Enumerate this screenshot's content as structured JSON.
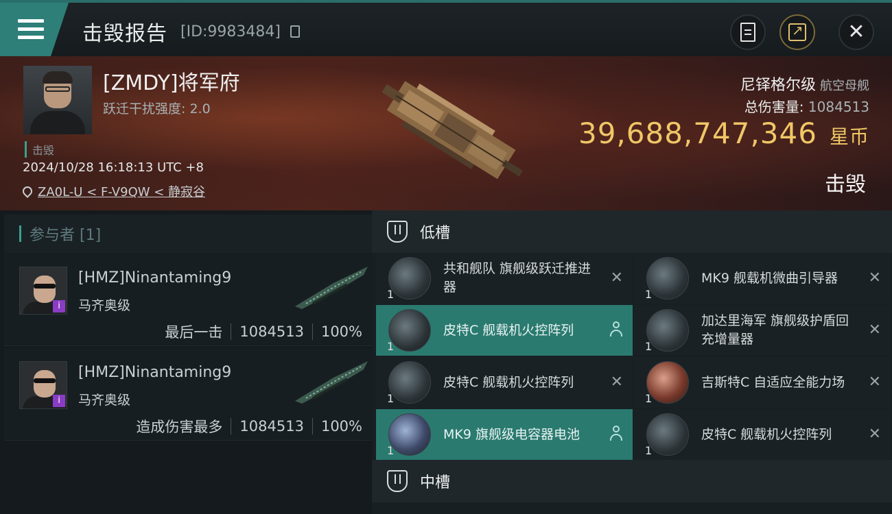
{
  "header": {
    "title": "击毁报告",
    "report_id": "[ID:9983484]",
    "menu_icon": "hamburger-menu-icon",
    "accent": "#2d7f78"
  },
  "victim": {
    "name": "[ZMDY]将军府",
    "jump_jam": "跃迁干扰强度: 2.0",
    "tag": "击毁",
    "datetime": "2024/10/28 16:18:13 UTC +8",
    "location": "ZA0L-U < F-V9QW < 静寂谷",
    "ship_name": "尼铎格尔级",
    "ship_type": "航空母舰",
    "total_damage_label": "总伤害量:",
    "total_damage": "1084513",
    "isk_value": "39,688,747,346",
    "isk_unit": "星币",
    "status": "击毁"
  },
  "participants": {
    "header": "参与者 [1]",
    "list": [
      {
        "name": "[HMZ]Ninantaming9",
        "ship": "马齐奥级",
        "role": "最后一击",
        "damage": "1084513",
        "percent": "100%"
      },
      {
        "name": "[HMZ]Ninantaming9",
        "ship": "马齐奥级",
        "role": "造成伤害最多",
        "damage": "1084513",
        "percent": "100%"
      }
    ]
  },
  "fitting": {
    "low_slot_label": "低槽",
    "mid_slot_label": "中槽",
    "low_modules": [
      {
        "name": "共和舰队 旗舰级跃迁推进器",
        "qty": "1",
        "state": "destroyed"
      },
      {
        "name": "MK9 舰载机微曲引导器",
        "qty": "1",
        "state": "destroyed"
      },
      {
        "name": "皮特C 舰载机火控阵列",
        "qty": "1",
        "state": "dropped"
      },
      {
        "name": "加达里海军 旗舰级护盾回充增量器",
        "qty": "1",
        "state": "destroyed"
      },
      {
        "name": "皮特C 舰载机火控阵列",
        "qty": "1",
        "state": "destroyed"
      },
      {
        "name": "吉斯特C 自适应全能力场",
        "qty": "1",
        "state": "destroyed"
      },
      {
        "name": "MK9 旗舰级电容器电池",
        "qty": "1",
        "state": "dropped"
      },
      {
        "name": "皮特C 舰载机火控阵列",
        "qty": "1",
        "state": "destroyed"
      }
    ]
  },
  "icons": {
    "destroyed": "x-icon",
    "dropped": "user-icon",
    "isk_color": "#f0c767"
  }
}
